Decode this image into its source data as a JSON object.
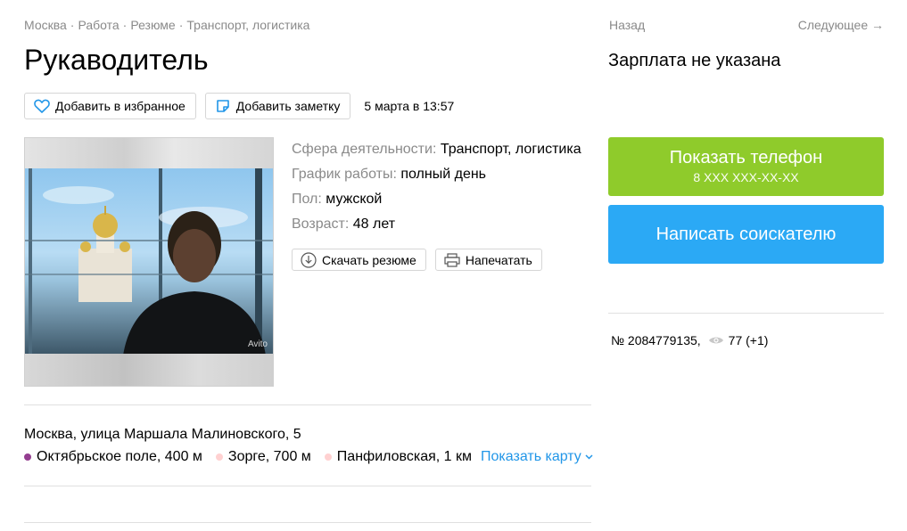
{
  "breadcrumbs": [
    {
      "label": "Москва"
    },
    {
      "label": "Работа"
    },
    {
      "label": "Резюме"
    },
    {
      "label": "Транспорт, логистика"
    }
  ],
  "breadcrumb_separator": "·",
  "title": "Рукаводитель",
  "actions": {
    "favorite_label": "Добавить в избранное",
    "note_label": "Добавить заметку",
    "date": "5 марта в 13:57"
  },
  "details": [
    {
      "label": "Сфера деятельности:",
      "value": "Транспорт, логистика"
    },
    {
      "label": "График работы:",
      "value": "полный день"
    },
    {
      "label": "Пол:",
      "value": "мужской"
    },
    {
      "label": "Возраст:",
      "value": "48 лет"
    }
  ],
  "doc_actions": {
    "download_label": "Скачать резюме",
    "print_label": "Напечатать"
  },
  "photo": {
    "watermark": "Avito"
  },
  "location": {
    "address": "Москва, улица Маршала Малиновского, 5",
    "metro": [
      {
        "name": "Октябрьское поле, 400 м",
        "color": "#943e90"
      },
      {
        "name": "Зорге, 700 м",
        "color": "#ffd1d1"
      },
      {
        "name": "Панфиловская, 1 км",
        "color": "#ffd1d1"
      }
    ],
    "map_link": "Показать карту"
  },
  "nav": {
    "back": "Назад",
    "next": "Следующее →"
  },
  "salary": "Зарплата не указана",
  "phone_button": {
    "label": "Показать телефон",
    "number": "8 XXX XXX-XX-XX",
    "color": "#8fcb2b"
  },
  "write_button": {
    "label": "Написать соискателю",
    "color": "#2ba9f5"
  },
  "stats": {
    "number": "№ 2084779135,",
    "views": "77 (+1)"
  }
}
